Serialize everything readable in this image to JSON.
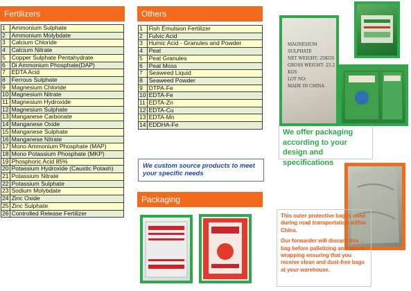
{
  "fertilizers": {
    "header": "Fertilizers",
    "items": [
      {
        "n": "1",
        "name": "Ammonium Sulphate"
      },
      {
        "n": "2",
        "name": "Ammonium Molybdate"
      },
      {
        "n": "3",
        "name": "Calcium Chloride"
      },
      {
        "n": "4",
        "name": "Calcium Nitrate"
      },
      {
        "n": "5",
        "name": "Copper Sulphate Pentahydrate"
      },
      {
        "n": "6",
        "name": "Di Ammonium Phosphate(DAP)"
      },
      {
        "n": "7",
        "name": "EDTA Acid"
      },
      {
        "n": "8",
        "name": "Ferrous Sulphate"
      },
      {
        "n": "9",
        "name": "Magnesium Chloride"
      },
      {
        "n": "10",
        "name": "Magnesium Nitrate"
      },
      {
        "n": "11",
        "name": "Magnesium Hydroxide"
      },
      {
        "n": "12",
        "name": "Magnesium Sulphate"
      },
      {
        "n": "13",
        "name": "Manganese Carbonate"
      },
      {
        "n": "14",
        "name": "Manganese Oxide"
      },
      {
        "n": "15",
        "name": "Manganese Sulphate"
      },
      {
        "n": "16",
        "name": "Manganese Nitrate"
      },
      {
        "n": "17",
        "name": "Mono Ammonium Phosphate (MAP)"
      },
      {
        "n": "18",
        "name": "Mono Potassium Phosphate (MKP)"
      },
      {
        "n": "19",
        "name": "Phosphoric Acid 85%"
      },
      {
        "n": "20",
        "name": "Potassium Hydroxide  (Caustic Potash)"
      },
      {
        "n": "21",
        "name": "Potassium Nitrate"
      },
      {
        "n": "22",
        "name": "Potassium Sulphate"
      },
      {
        "n": "23",
        "name": "Sodium Molybdate"
      },
      {
        "n": "24",
        "name": "Zinc Oxide"
      },
      {
        "n": "25",
        "name": "Zinc Sulphate"
      },
      {
        "n": "26",
        "name": "Controlled Release Fertilizer"
      }
    ]
  },
  "others": {
    "header": "Others",
    "items": [
      {
        "n": "1",
        "name": "Fish Emulsion Fertilizer"
      },
      {
        "n": "2",
        "name": "Fulvic Acid"
      },
      {
        "n": "3",
        "name": "Humic Acid - Granules and Powder"
      },
      {
        "n": "4",
        "name": "Peat"
      },
      {
        "n": "5",
        "name": "Peat Granules"
      },
      {
        "n": "6",
        "name": "Peat Moss"
      },
      {
        "n": "7",
        "name": "Seaweed Liquid"
      },
      {
        "n": "8",
        "name": "Seaweed Powder"
      },
      {
        "n": "9",
        "name": "DTPA-Fe"
      },
      {
        "n": "10",
        "name": "EDTA-Fe"
      },
      {
        "n": "11",
        "name": "EDTA-Zn"
      },
      {
        "n": "12",
        "name": "EDTA-Cu"
      },
      {
        "n": "13",
        "name": "EDTA-Mn"
      },
      {
        "n": "14",
        "name": "EDDHA-Fe"
      }
    ]
  },
  "custom_note": "We custom source products to meet your specific needs",
  "packaging": {
    "header": "Packaging"
  },
  "offer_text": "We offer packaging according to your design and specifications",
  "outer_bag": {
    "para1": "This outer protective bag is used during road transportation within China.",
    "para2": "Our forwarder will discard this bag before palletizing and shrink wrapping ensuring that you receive clean and dust-free bags at your warehouse."
  },
  "bag_label": {
    "line1": "MAGNESIUM SULPHATE",
    "line2": "NET WEIGHT: 25KGS",
    "line3": "GROSS WEIGHT: 25.2 KGS",
    "line4": "LOT NO:",
    "line5": "MADE IN CHINA"
  },
  "colors": {
    "header_orange": "#f26b1d",
    "frame_green": "#2da84a",
    "row_yellow": "#ffffcc",
    "row_green": "#e6eed3",
    "custom_blue": "#1e46b4"
  }
}
